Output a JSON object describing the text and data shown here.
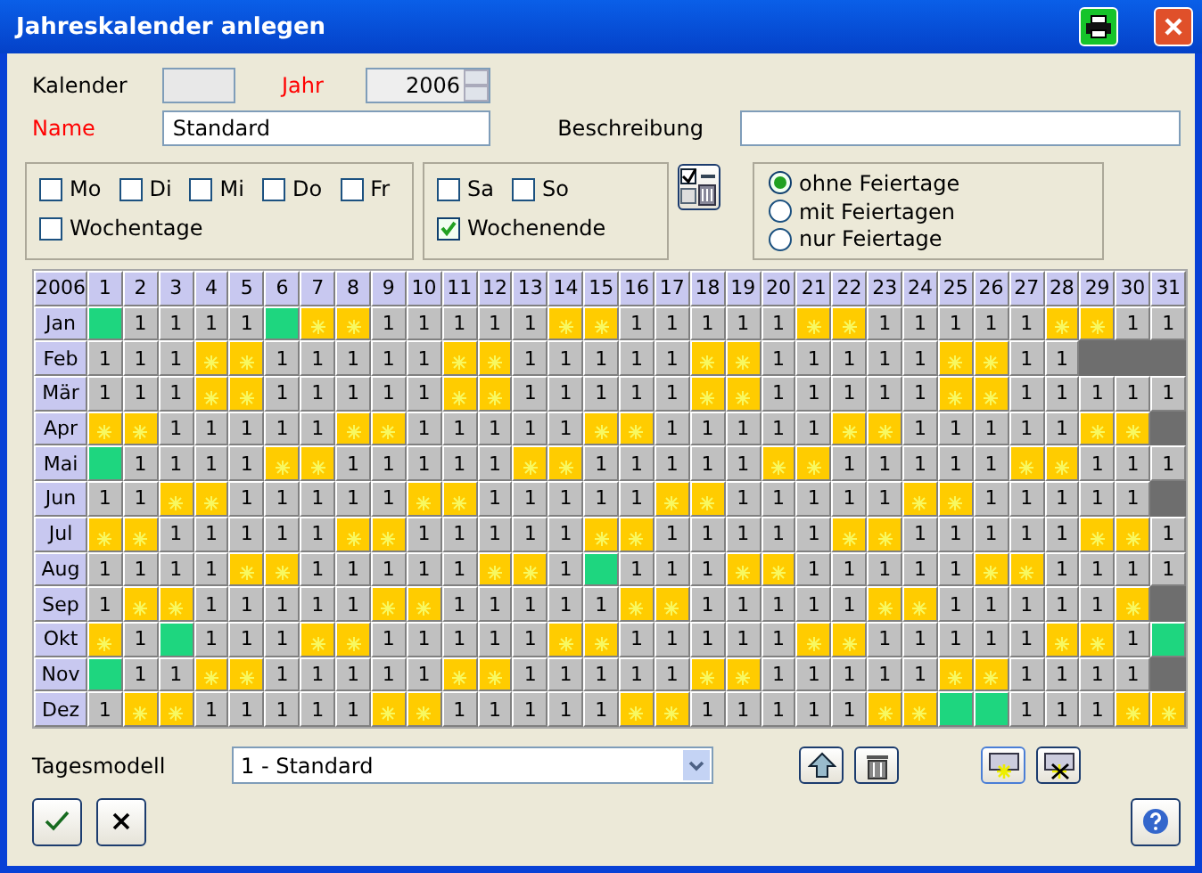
{
  "window": {
    "title": "Jahreskalender anlegen"
  },
  "fields": {
    "kalender": {
      "label": "Kalender",
      "required": false
    },
    "jahr": {
      "label": "Jahr",
      "required": true,
      "value": "2006"
    },
    "name": {
      "label": "Name",
      "required": true,
      "value": "Standard"
    },
    "beschreibung": {
      "label": "Beschreibung",
      "required": false
    }
  },
  "weekdays": [
    {
      "label": "Mo",
      "checked": false
    },
    {
      "label": "Di",
      "checked": false
    },
    {
      "label": "Mi",
      "checked": false
    },
    {
      "label": "Do",
      "checked": false
    },
    {
      "label": "Fr",
      "checked": false
    }
  ],
  "weekdays_all": {
    "label": "Wochentage",
    "checked": false
  },
  "weekend": [
    {
      "label": "Sa",
      "checked": false
    },
    {
      "label": "So",
      "checked": false
    }
  ],
  "weekend_all": {
    "label": "Wochenende",
    "checked": true
  },
  "holiday_options": [
    {
      "label": "ohne Feiertage",
      "selected": true
    },
    {
      "label": "mit Feiertagen",
      "selected": false
    },
    {
      "label": "nur Feiertage",
      "selected": false
    }
  ],
  "calendar": {
    "year_label": "2006",
    "days": [
      "1",
      "2",
      "3",
      "4",
      "5",
      "6",
      "7",
      "8",
      "9",
      "10",
      "11",
      "12",
      "13",
      "14",
      "15",
      "16",
      "17",
      "18",
      "19",
      "20",
      "21",
      "22",
      "23",
      "24",
      "25",
      "26",
      "27",
      "28",
      "29",
      "30",
      "31"
    ],
    "months": [
      {
        "label": "Jan",
        "cells": [
          {
            "kind": "holiday"
          },
          {
            "kind": "work",
            "text": "1"
          },
          {
            "kind": "work",
            "text": "1"
          },
          {
            "kind": "work",
            "text": "1"
          },
          {
            "kind": "work",
            "text": "1"
          },
          {
            "kind": "holiday"
          },
          {
            "kind": "weekend"
          },
          {
            "kind": "weekend"
          },
          {
            "kind": "work",
            "text": "1"
          },
          {
            "kind": "work",
            "text": "1"
          },
          {
            "kind": "work",
            "text": "1"
          },
          {
            "kind": "work",
            "text": "1"
          },
          {
            "kind": "work",
            "text": "1"
          },
          {
            "kind": "weekend"
          },
          {
            "kind": "weekend"
          },
          {
            "kind": "work",
            "text": "1"
          },
          {
            "kind": "work",
            "text": "1"
          },
          {
            "kind": "work",
            "text": "1"
          },
          {
            "kind": "work",
            "text": "1"
          },
          {
            "kind": "work",
            "text": "1"
          },
          {
            "kind": "weekend"
          },
          {
            "kind": "weekend"
          },
          {
            "kind": "work",
            "text": "1"
          },
          {
            "kind": "work",
            "text": "1"
          },
          {
            "kind": "work",
            "text": "1"
          },
          {
            "kind": "work",
            "text": "1"
          },
          {
            "kind": "work",
            "text": "1"
          },
          {
            "kind": "weekend"
          },
          {
            "kind": "weekend"
          },
          {
            "kind": "work",
            "text": "1"
          },
          {
            "kind": "work",
            "text": "1"
          }
        ]
      },
      {
        "label": "Feb",
        "cells": [
          {
            "kind": "work",
            "text": "1"
          },
          {
            "kind": "work",
            "text": "1"
          },
          {
            "kind": "work",
            "text": "1"
          },
          {
            "kind": "weekend"
          },
          {
            "kind": "weekend"
          },
          {
            "kind": "work",
            "text": "1"
          },
          {
            "kind": "work",
            "text": "1"
          },
          {
            "kind": "work",
            "text": "1"
          },
          {
            "kind": "work",
            "text": "1"
          },
          {
            "kind": "work",
            "text": "1"
          },
          {
            "kind": "weekend"
          },
          {
            "kind": "weekend"
          },
          {
            "kind": "work",
            "text": "1"
          },
          {
            "kind": "work",
            "text": "1"
          },
          {
            "kind": "work",
            "text": "1"
          },
          {
            "kind": "work",
            "text": "1"
          },
          {
            "kind": "work",
            "text": "1"
          },
          {
            "kind": "weekend"
          },
          {
            "kind": "weekend"
          },
          {
            "kind": "work",
            "text": "1"
          },
          {
            "kind": "work",
            "text": "1"
          },
          {
            "kind": "work",
            "text": "1"
          },
          {
            "kind": "work",
            "text": "1"
          },
          {
            "kind": "work",
            "text": "1"
          },
          {
            "kind": "weekend"
          },
          {
            "kind": "weekend"
          },
          {
            "kind": "work",
            "text": "1"
          },
          {
            "kind": "work",
            "text": "1"
          },
          {
            "kind": "none"
          },
          {
            "kind": "none"
          },
          {
            "kind": "none"
          }
        ]
      },
      {
        "label": "Mär",
        "cells": [
          {
            "kind": "work",
            "text": "1"
          },
          {
            "kind": "work",
            "text": "1"
          },
          {
            "kind": "work",
            "text": "1"
          },
          {
            "kind": "weekend"
          },
          {
            "kind": "weekend"
          },
          {
            "kind": "work",
            "text": "1"
          },
          {
            "kind": "work",
            "text": "1"
          },
          {
            "kind": "work",
            "text": "1"
          },
          {
            "kind": "work",
            "text": "1"
          },
          {
            "kind": "work",
            "text": "1"
          },
          {
            "kind": "weekend"
          },
          {
            "kind": "weekend"
          },
          {
            "kind": "work",
            "text": "1"
          },
          {
            "kind": "work",
            "text": "1"
          },
          {
            "kind": "work",
            "text": "1"
          },
          {
            "kind": "work",
            "text": "1"
          },
          {
            "kind": "work",
            "text": "1"
          },
          {
            "kind": "weekend"
          },
          {
            "kind": "weekend"
          },
          {
            "kind": "work",
            "text": "1"
          },
          {
            "kind": "work",
            "text": "1"
          },
          {
            "kind": "work",
            "text": "1"
          },
          {
            "kind": "work",
            "text": "1"
          },
          {
            "kind": "work",
            "text": "1"
          },
          {
            "kind": "weekend"
          },
          {
            "kind": "weekend"
          },
          {
            "kind": "work",
            "text": "1"
          },
          {
            "kind": "work",
            "text": "1"
          },
          {
            "kind": "work",
            "text": "1"
          },
          {
            "kind": "work",
            "text": "1"
          },
          {
            "kind": "work",
            "text": "1"
          }
        ]
      },
      {
        "label": "Apr",
        "cells": [
          {
            "kind": "weekend"
          },
          {
            "kind": "weekend"
          },
          {
            "kind": "work",
            "text": "1"
          },
          {
            "kind": "work",
            "text": "1"
          },
          {
            "kind": "work",
            "text": "1"
          },
          {
            "kind": "work",
            "text": "1"
          },
          {
            "kind": "work",
            "text": "1"
          },
          {
            "kind": "weekend"
          },
          {
            "kind": "weekend"
          },
          {
            "kind": "work",
            "text": "1"
          },
          {
            "kind": "work",
            "text": "1"
          },
          {
            "kind": "work",
            "text": "1"
          },
          {
            "kind": "work",
            "text": "1"
          },
          {
            "kind": "work",
            "text": "1"
          },
          {
            "kind": "weekend"
          },
          {
            "kind": "weekend"
          },
          {
            "kind": "work",
            "text": "1"
          },
          {
            "kind": "work",
            "text": "1"
          },
          {
            "kind": "work",
            "text": "1"
          },
          {
            "kind": "work",
            "text": "1"
          },
          {
            "kind": "work",
            "text": "1"
          },
          {
            "kind": "weekend"
          },
          {
            "kind": "weekend"
          },
          {
            "kind": "work",
            "text": "1"
          },
          {
            "kind": "work",
            "text": "1"
          },
          {
            "kind": "work",
            "text": "1"
          },
          {
            "kind": "work",
            "text": "1"
          },
          {
            "kind": "work",
            "text": "1"
          },
          {
            "kind": "weekend"
          },
          {
            "kind": "weekend"
          },
          {
            "kind": "none"
          }
        ]
      },
      {
        "label": "Mai",
        "cells": [
          {
            "kind": "holiday"
          },
          {
            "kind": "work",
            "text": "1"
          },
          {
            "kind": "work",
            "text": "1"
          },
          {
            "kind": "work",
            "text": "1"
          },
          {
            "kind": "work",
            "text": "1"
          },
          {
            "kind": "weekend"
          },
          {
            "kind": "weekend"
          },
          {
            "kind": "work",
            "text": "1"
          },
          {
            "kind": "work",
            "text": "1"
          },
          {
            "kind": "work",
            "text": "1"
          },
          {
            "kind": "work",
            "text": "1"
          },
          {
            "kind": "work",
            "text": "1"
          },
          {
            "kind": "weekend"
          },
          {
            "kind": "weekend"
          },
          {
            "kind": "work",
            "text": "1"
          },
          {
            "kind": "work",
            "text": "1"
          },
          {
            "kind": "work",
            "text": "1"
          },
          {
            "kind": "work",
            "text": "1"
          },
          {
            "kind": "work",
            "text": "1"
          },
          {
            "kind": "weekend"
          },
          {
            "kind": "weekend"
          },
          {
            "kind": "work",
            "text": "1"
          },
          {
            "kind": "work",
            "text": "1"
          },
          {
            "kind": "work",
            "text": "1"
          },
          {
            "kind": "work",
            "text": "1"
          },
          {
            "kind": "work",
            "text": "1"
          },
          {
            "kind": "weekend"
          },
          {
            "kind": "weekend"
          },
          {
            "kind": "work",
            "text": "1"
          },
          {
            "kind": "work",
            "text": "1"
          },
          {
            "kind": "work",
            "text": "1"
          }
        ]
      },
      {
        "label": "Jun",
        "cells": [
          {
            "kind": "work",
            "text": "1"
          },
          {
            "kind": "work",
            "text": "1"
          },
          {
            "kind": "weekend"
          },
          {
            "kind": "weekend"
          },
          {
            "kind": "work",
            "text": "1"
          },
          {
            "kind": "work",
            "text": "1"
          },
          {
            "kind": "work",
            "text": "1"
          },
          {
            "kind": "work",
            "text": "1"
          },
          {
            "kind": "work",
            "text": "1"
          },
          {
            "kind": "weekend"
          },
          {
            "kind": "weekend"
          },
          {
            "kind": "work",
            "text": "1"
          },
          {
            "kind": "work",
            "text": "1"
          },
          {
            "kind": "work",
            "text": "1"
          },
          {
            "kind": "work",
            "text": "1"
          },
          {
            "kind": "work",
            "text": "1"
          },
          {
            "kind": "weekend"
          },
          {
            "kind": "weekend"
          },
          {
            "kind": "work",
            "text": "1"
          },
          {
            "kind": "work",
            "text": "1"
          },
          {
            "kind": "work",
            "text": "1"
          },
          {
            "kind": "work",
            "text": "1"
          },
          {
            "kind": "work",
            "text": "1"
          },
          {
            "kind": "weekend"
          },
          {
            "kind": "weekend"
          },
          {
            "kind": "work",
            "text": "1"
          },
          {
            "kind": "work",
            "text": "1"
          },
          {
            "kind": "work",
            "text": "1"
          },
          {
            "kind": "work",
            "text": "1"
          },
          {
            "kind": "work",
            "text": "1"
          },
          {
            "kind": "none"
          }
        ]
      },
      {
        "label": "Jul",
        "cells": [
          {
            "kind": "weekend"
          },
          {
            "kind": "weekend"
          },
          {
            "kind": "work",
            "text": "1"
          },
          {
            "kind": "work",
            "text": "1"
          },
          {
            "kind": "work",
            "text": "1"
          },
          {
            "kind": "work",
            "text": "1"
          },
          {
            "kind": "work",
            "text": "1"
          },
          {
            "kind": "weekend"
          },
          {
            "kind": "weekend"
          },
          {
            "kind": "work",
            "text": "1"
          },
          {
            "kind": "work",
            "text": "1"
          },
          {
            "kind": "work",
            "text": "1"
          },
          {
            "kind": "work",
            "text": "1"
          },
          {
            "kind": "work",
            "text": "1"
          },
          {
            "kind": "weekend"
          },
          {
            "kind": "weekend"
          },
          {
            "kind": "work",
            "text": "1"
          },
          {
            "kind": "work",
            "text": "1"
          },
          {
            "kind": "work",
            "text": "1"
          },
          {
            "kind": "work",
            "text": "1"
          },
          {
            "kind": "work",
            "text": "1"
          },
          {
            "kind": "weekend"
          },
          {
            "kind": "weekend"
          },
          {
            "kind": "work",
            "text": "1"
          },
          {
            "kind": "work",
            "text": "1"
          },
          {
            "kind": "work",
            "text": "1"
          },
          {
            "kind": "work",
            "text": "1"
          },
          {
            "kind": "work",
            "text": "1"
          },
          {
            "kind": "weekend"
          },
          {
            "kind": "weekend"
          },
          {
            "kind": "work",
            "text": "1"
          }
        ]
      },
      {
        "label": "Aug",
        "cells": [
          {
            "kind": "work",
            "text": "1"
          },
          {
            "kind": "work",
            "text": "1"
          },
          {
            "kind": "work",
            "text": "1"
          },
          {
            "kind": "work",
            "text": "1"
          },
          {
            "kind": "weekend"
          },
          {
            "kind": "weekend"
          },
          {
            "kind": "work",
            "text": "1"
          },
          {
            "kind": "work",
            "text": "1"
          },
          {
            "kind": "work",
            "text": "1"
          },
          {
            "kind": "work",
            "text": "1"
          },
          {
            "kind": "work",
            "text": "1"
          },
          {
            "kind": "weekend"
          },
          {
            "kind": "weekend"
          },
          {
            "kind": "work",
            "text": "1"
          },
          {
            "kind": "holiday"
          },
          {
            "kind": "work",
            "text": "1"
          },
          {
            "kind": "work",
            "text": "1"
          },
          {
            "kind": "work",
            "text": "1"
          },
          {
            "kind": "weekend"
          },
          {
            "kind": "weekend"
          },
          {
            "kind": "work",
            "text": "1"
          },
          {
            "kind": "work",
            "text": "1"
          },
          {
            "kind": "work",
            "text": "1"
          },
          {
            "kind": "work",
            "text": "1"
          },
          {
            "kind": "work",
            "text": "1"
          },
          {
            "kind": "weekend"
          },
          {
            "kind": "weekend"
          },
          {
            "kind": "work",
            "text": "1"
          },
          {
            "kind": "work",
            "text": "1"
          },
          {
            "kind": "work",
            "text": "1"
          },
          {
            "kind": "work",
            "text": "1"
          }
        ]
      },
      {
        "label": "Sep",
        "cells": [
          {
            "kind": "work",
            "text": "1"
          },
          {
            "kind": "weekend"
          },
          {
            "kind": "weekend"
          },
          {
            "kind": "work",
            "text": "1"
          },
          {
            "kind": "work",
            "text": "1"
          },
          {
            "kind": "work",
            "text": "1"
          },
          {
            "kind": "work",
            "text": "1"
          },
          {
            "kind": "work",
            "text": "1"
          },
          {
            "kind": "weekend"
          },
          {
            "kind": "weekend"
          },
          {
            "kind": "work",
            "text": "1"
          },
          {
            "kind": "work",
            "text": "1"
          },
          {
            "kind": "work",
            "text": "1"
          },
          {
            "kind": "work",
            "text": "1"
          },
          {
            "kind": "work",
            "text": "1"
          },
          {
            "kind": "weekend"
          },
          {
            "kind": "weekend"
          },
          {
            "kind": "work",
            "text": "1"
          },
          {
            "kind": "work",
            "text": "1"
          },
          {
            "kind": "work",
            "text": "1"
          },
          {
            "kind": "work",
            "text": "1"
          },
          {
            "kind": "work",
            "text": "1"
          },
          {
            "kind": "weekend"
          },
          {
            "kind": "weekend"
          },
          {
            "kind": "work",
            "text": "1"
          },
          {
            "kind": "work",
            "text": "1"
          },
          {
            "kind": "work",
            "text": "1"
          },
          {
            "kind": "work",
            "text": "1"
          },
          {
            "kind": "work",
            "text": "1"
          },
          {
            "kind": "weekend"
          },
          {
            "kind": "none"
          }
        ]
      },
      {
        "label": "Okt",
        "cells": [
          {
            "kind": "weekend"
          },
          {
            "kind": "work",
            "text": "1"
          },
          {
            "kind": "holiday"
          },
          {
            "kind": "work",
            "text": "1"
          },
          {
            "kind": "work",
            "text": "1"
          },
          {
            "kind": "work",
            "text": "1"
          },
          {
            "kind": "weekend"
          },
          {
            "kind": "weekend"
          },
          {
            "kind": "work",
            "text": "1"
          },
          {
            "kind": "work",
            "text": "1"
          },
          {
            "kind": "work",
            "text": "1"
          },
          {
            "kind": "work",
            "text": "1"
          },
          {
            "kind": "work",
            "text": "1"
          },
          {
            "kind": "weekend"
          },
          {
            "kind": "weekend"
          },
          {
            "kind": "work",
            "text": "1"
          },
          {
            "kind": "work",
            "text": "1"
          },
          {
            "kind": "work",
            "text": "1"
          },
          {
            "kind": "work",
            "text": "1"
          },
          {
            "kind": "work",
            "text": "1"
          },
          {
            "kind": "weekend"
          },
          {
            "kind": "weekend"
          },
          {
            "kind": "work",
            "text": "1"
          },
          {
            "kind": "work",
            "text": "1"
          },
          {
            "kind": "work",
            "text": "1"
          },
          {
            "kind": "work",
            "text": "1"
          },
          {
            "kind": "work",
            "text": "1"
          },
          {
            "kind": "weekend"
          },
          {
            "kind": "weekend"
          },
          {
            "kind": "work",
            "text": "1"
          },
          {
            "kind": "holiday"
          }
        ]
      },
      {
        "label": "Nov",
        "cells": [
          {
            "kind": "holiday"
          },
          {
            "kind": "work",
            "text": "1"
          },
          {
            "kind": "work",
            "text": "1"
          },
          {
            "kind": "weekend"
          },
          {
            "kind": "weekend"
          },
          {
            "kind": "work",
            "text": "1"
          },
          {
            "kind": "work",
            "text": "1"
          },
          {
            "kind": "work",
            "text": "1"
          },
          {
            "kind": "work",
            "text": "1"
          },
          {
            "kind": "work",
            "text": "1"
          },
          {
            "kind": "weekend"
          },
          {
            "kind": "weekend"
          },
          {
            "kind": "work",
            "text": "1"
          },
          {
            "kind": "work",
            "text": "1"
          },
          {
            "kind": "work",
            "text": "1"
          },
          {
            "kind": "work",
            "text": "1"
          },
          {
            "kind": "work",
            "text": "1"
          },
          {
            "kind": "weekend"
          },
          {
            "kind": "weekend"
          },
          {
            "kind": "work",
            "text": "1"
          },
          {
            "kind": "work",
            "text": "1"
          },
          {
            "kind": "work",
            "text": "1"
          },
          {
            "kind": "work",
            "text": "1"
          },
          {
            "kind": "work",
            "text": "1"
          },
          {
            "kind": "weekend"
          },
          {
            "kind": "weekend"
          },
          {
            "kind": "work",
            "text": "1"
          },
          {
            "kind": "work",
            "text": "1"
          },
          {
            "kind": "work",
            "text": "1"
          },
          {
            "kind": "work",
            "text": "1"
          },
          {
            "kind": "none"
          }
        ]
      },
      {
        "label": "Dez",
        "cells": [
          {
            "kind": "work",
            "text": "1"
          },
          {
            "kind": "weekend"
          },
          {
            "kind": "weekend"
          },
          {
            "kind": "work",
            "text": "1"
          },
          {
            "kind": "work",
            "text": "1"
          },
          {
            "kind": "work",
            "text": "1"
          },
          {
            "kind": "work",
            "text": "1"
          },
          {
            "kind": "work",
            "text": "1"
          },
          {
            "kind": "weekend"
          },
          {
            "kind": "weekend"
          },
          {
            "kind": "work",
            "text": "1"
          },
          {
            "kind": "work",
            "text": "1"
          },
          {
            "kind": "work",
            "text": "1"
          },
          {
            "kind": "work",
            "text": "1"
          },
          {
            "kind": "work",
            "text": "1"
          },
          {
            "kind": "weekend"
          },
          {
            "kind": "weekend"
          },
          {
            "kind": "work",
            "text": "1"
          },
          {
            "kind": "work",
            "text": "1"
          },
          {
            "kind": "work",
            "text": "1"
          },
          {
            "kind": "work",
            "text": "1"
          },
          {
            "kind": "work",
            "text": "1"
          },
          {
            "kind": "weekend"
          },
          {
            "kind": "weekend"
          },
          {
            "kind": "holiday"
          },
          {
            "kind": "holiday"
          },
          {
            "kind": "work",
            "text": "1"
          },
          {
            "kind": "work",
            "text": "1"
          },
          {
            "kind": "work",
            "text": "1"
          },
          {
            "kind": "weekend"
          },
          {
            "kind": "weekend"
          }
        ]
      }
    ]
  },
  "tagesmodell": {
    "label": "Tagesmodell",
    "value": "1 - Standard"
  }
}
